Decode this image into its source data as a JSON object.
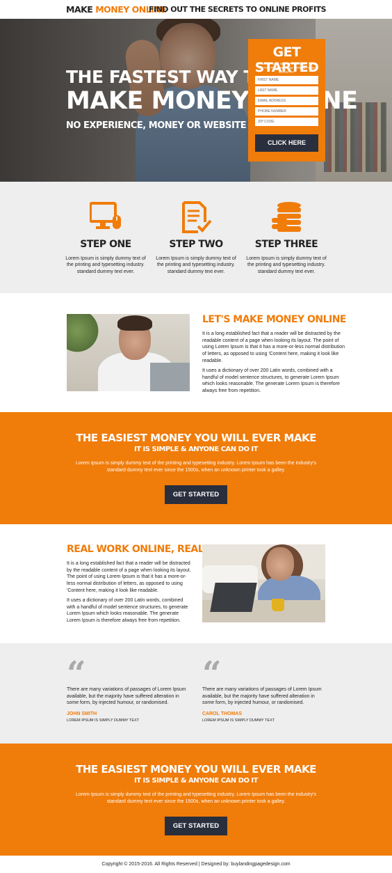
{
  "header": {
    "logo_part1": "MAKE ",
    "logo_part2": "MONEY ONLINE",
    "tagline": "FIND OUT THE SECRETS TO ONLINE PROFITS"
  },
  "hero": {
    "title_line1": "THE FASTEST WAY TO",
    "title_line2": "MAKE MONEY ONLINE",
    "subtitle": "NO EXPERIENCE, MONEY OR WEBSITE NEEDED"
  },
  "form": {
    "title": "GET STARTED",
    "subtitle": "LOREM IPSUM IS SIMPLY DUMMY TEXT OF THE PRINTING AND TYPESETTING INDUSTRY.",
    "fields": {
      "first_name": "FIRST NAME",
      "last_name": "LAST NAME",
      "email": "EMAIL ADDRESS",
      "phone": "PHONE NUMBER",
      "zip": "ZIP CODE"
    },
    "button": "CLICK HERE"
  },
  "steps": [
    {
      "title": "STEP ONE",
      "text": "Lorem Ipsum is simply dummy text of the printing and typesetting industry. standard dummy text ever.",
      "icon": "monitor-mouse-icon"
    },
    {
      "title": "STEP TWO",
      "text": "Lorem Ipsum is simply dummy text of the printing and typesetting industry. standard dummy text ever.",
      "icon": "document-check-icon"
    },
    {
      "title": "STEP THREE",
      "text": "Lorem Ipsum is simply dummy text of the printing and typesetting industry. standard dummy text ever.",
      "icon": "coins-stack-icon"
    }
  ],
  "feature1": {
    "title": "LET'S MAKE MONEY ONLINE",
    "para1": "It is a long established fact that a reader will be distracted by the readable content of a page when looking its layout. The point of using Lorem Ipsum is that it has a more-or-less normal distribution of letters, as opposed to using 'Content here, making it look like readable.",
    "para2": "It uses a dictionary of over 200 Latin words, combined with a handful of model sentence structures, to generate Lorem Ipsum which looks reasonable. The generate Lorem Ipsum is therefore always free from repetition."
  },
  "band1": {
    "title": "THE EASIEST MONEY YOU WILL EVER MAKE",
    "subtitle": "IT IS SIMPLE & ANYONE CAN DO IT",
    "text": "Lorem Ipsum is simply dummy text of the printing and typesetting industry. Lorem Ipsum has been the industry's standard dummy text ever since the 1500s, when an unknown printer took a galley.",
    "button": "GET STARTED"
  },
  "feature2": {
    "title": "REAL WORK ONLINE, REAL MONEY",
    "para1": "It is a long established fact that a reader will be distracted by the readable content of a page when looking its layout. The point of using Lorem Ipsum is that it has a more-or-less normal distribution of letters, as opposed to using 'Content here, making it look like readable.",
    "para2": "It uses a dictionary of over 200 Latin words, combined with a handful of model sentence structures, to generate Lorem Ipsum which looks reasonable. The generate Lorem Ipsum is therefore always free from repetition."
  },
  "testimonials": [
    {
      "quote": "There are many variations of passages of Lorem Ipsum available, but the majority have suffered alteration in some form, by injected humour, or randomised.",
      "name": "JOHN SMITH",
      "role": "LOREM IPSUM IS SIMPLY DUMMY TEXT"
    },
    {
      "quote": "There are many variations of passages of Lorem Ipsum available, but the majority have suffered alteration in some form, by injected humour, or randomised.",
      "name": "CAROL THOMAS",
      "role": "LOREM IPSUM IS SIMPLY DUMMY TEXT"
    }
  ],
  "band2": {
    "title": "THE EASIEST MONEY YOU WILL EVER MAKE",
    "subtitle": "IT IS SIMPLE & ANYONE CAN DO IT",
    "text": "Lorem Ipsum is simply dummy text of the printing and typesetting industry. Lorem Ipsum has been the industry's standard dummy text ever since the 1500s, when an unknown printer took a galley.",
    "button": "GET STARTED"
  },
  "footer": {
    "text": "Copyright © 2015-2016. All Rights Reserved  |  Designed by: buylandingpagedesign.com"
  },
  "colors": {
    "accent": "#f07c0a",
    "button_dark": "#2a2f3d",
    "section_gray": "#eeeeee"
  }
}
